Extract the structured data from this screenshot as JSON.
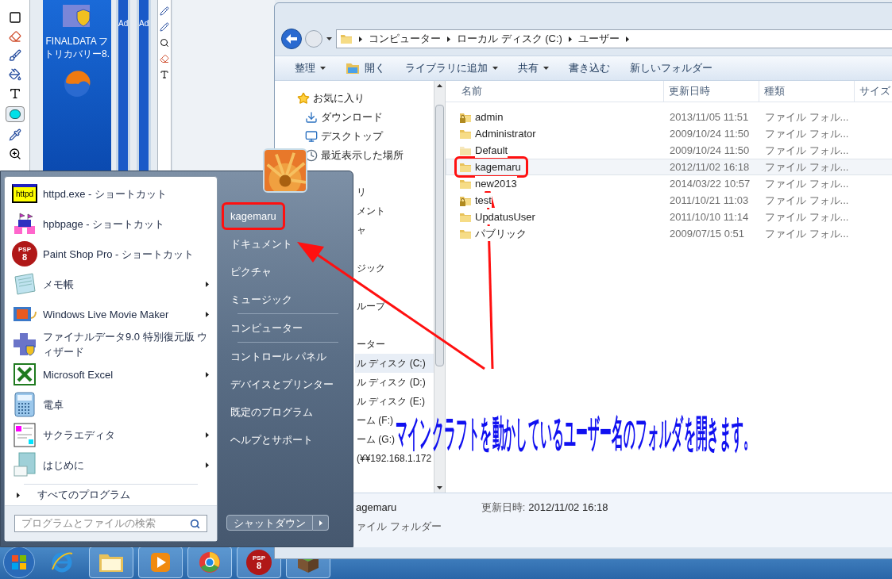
{
  "desktop": {
    "icon_label": [
      "FINALDATA フ",
      "トリカバリー8."
    ],
    "window_fragments": [
      "Ad",
      "Ad"
    ]
  },
  "explorer": {
    "breadcrumb": [
      "コンピューター",
      "ローカル ディスク (C:)",
      "ユーザー"
    ],
    "toolbar": [
      {
        "label": "整理",
        "dropdown": true,
        "kind": "text"
      },
      {
        "label": "開く",
        "dropdown": false,
        "kind": "open"
      },
      {
        "label": "ライブラリに追加",
        "dropdown": true,
        "kind": "text"
      },
      {
        "label": "共有",
        "dropdown": true,
        "kind": "text"
      },
      {
        "label": "書き込む",
        "dropdown": false,
        "kind": "text"
      },
      {
        "label": "新しいフォルダー",
        "dropdown": false,
        "kind": "text"
      }
    ],
    "columns": [
      "名前",
      "更新日時",
      "種類",
      "サイズ"
    ],
    "nav": [
      {
        "label": "お気に入り",
        "kind": "star"
      },
      {
        "label": "ダウンロード",
        "kind": "download"
      },
      {
        "label": "デスクトップ",
        "kind": "desktop"
      },
      {
        "label": "最近表示した場所",
        "kind": "recent"
      }
    ],
    "nav_partial": [
      {
        "label": "リ",
        "selected": false
      },
      {
        "label": "メント",
        "selected": false
      },
      {
        "label": "ャ",
        "selected": false
      },
      {
        "label": "ジック",
        "selected": false
      },
      {
        "label": "ループ",
        "selected": false
      },
      {
        "label": "ーター",
        "selected": false
      },
      {
        "label": "ル ディスク (C:)",
        "selected": true
      },
      {
        "label": "ル ディスク (D:)",
        "selected": false
      },
      {
        "label": "ル ディスク (E:)",
        "selected": false
      },
      {
        "label": "ーム (F:)",
        "selected": false
      },
      {
        "label": "ーム (G:)",
        "selected": false
      },
      {
        "label": "(¥¥192.168.1.172",
        "selected": false
      }
    ],
    "rows": [
      {
        "name": "admin",
        "date": "2013/11/05 11:51",
        "type": "ファイル フォル...",
        "kind": "locked",
        "selected": false,
        "circled": false
      },
      {
        "name": "Administrator",
        "date": "2009/10/24 11:50",
        "type": "ファイル フォル...",
        "kind": "plain",
        "selected": false,
        "circled": false
      },
      {
        "name": "Default",
        "date": "2009/10/24 11:50",
        "type": "ファイル フォル...",
        "kind": "faint",
        "selected": false,
        "circled": false
      },
      {
        "name": "kagemaru",
        "date": "2012/11/02 16:18",
        "type": "ファイル フォル...",
        "kind": "plain",
        "selected": true,
        "circled": true
      },
      {
        "name": "new2013",
        "date": "2014/03/22 10:57",
        "type": "ファイル フォル...",
        "kind": "plain",
        "selected": false,
        "circled": false
      },
      {
        "name": "test",
        "date": "2011/10/21 11:03",
        "type": "ファイル フォル...",
        "kind": "locked",
        "selected": false,
        "circled": false
      },
      {
        "name": "UpdatusUser",
        "date": "2011/10/10 11:14",
        "type": "ファイル フォル...",
        "kind": "plain",
        "selected": false,
        "circled": false
      },
      {
        "name": "パブリック",
        "date": "2009/07/15 0:51",
        "type": "ファイル フォル...",
        "kind": "plain",
        "selected": false,
        "circled": false
      }
    ],
    "details": {
      "name": "agemaru",
      "date_label": "更新日時:",
      "date": "2012/11/02 16:18",
      "type": "ァイル フォルダー"
    }
  },
  "start_menu": {
    "programs": [
      {
        "label": "httpd.exe - ショートカット",
        "kind": "httpd",
        "icon_text": [
          "httpd"
        ],
        "submenu": false
      },
      {
        "label": "hpbpage - ショートカット",
        "kind": "castle",
        "submenu": false
      },
      {
        "label": "Paint Shop Pro - ショートカット",
        "kind": "psp",
        "icon_text": [
          "PSP",
          "8"
        ],
        "submenu": false
      },
      {
        "label": "メモ帳",
        "kind": "notepad",
        "submenu": true
      },
      {
        "label": "Windows Live Movie Maker",
        "kind": "movie",
        "submenu": true
      },
      {
        "label": "ファイナルデータ9.0 特別復元版 ウィザード",
        "kind": "finaldata",
        "submenu": false
      },
      {
        "label": "Microsoft Excel",
        "kind": "excel",
        "submenu": true
      },
      {
        "label": "電卓",
        "kind": "calc",
        "submenu": false
      },
      {
        "label": "サクラエディタ",
        "kind": "sakura",
        "submenu": true
      },
      {
        "label": "はじめに",
        "kind": "intro",
        "submenu": true
      }
    ],
    "all_programs": "すべてのプログラム",
    "search_placeholder": "プログラムとファイルの検索",
    "places": [
      {
        "label": "kagemaru",
        "separator_before": false,
        "circled": true
      },
      {
        "label": "ドキュメント",
        "separator_before": false,
        "circled": false
      },
      {
        "label": "ピクチャ",
        "separator_before": false,
        "circled": false
      },
      {
        "label": "ミュージック",
        "separator_before": false,
        "circled": false
      },
      {
        "label": "コンピューター",
        "separator_before": true,
        "circled": false
      },
      {
        "label": "コントロール パネル",
        "separator_before": true,
        "circled": false
      },
      {
        "label": "デバイスとプリンター",
        "separator_before": false,
        "circled": false
      },
      {
        "label": "既定のプログラム",
        "separator_before": false,
        "circled": false
      },
      {
        "label": "ヘルプとサポート",
        "separator_before": false,
        "circled": false
      }
    ],
    "shutdown": "シャットダウン"
  },
  "taskbar": [
    {
      "kind": "ie",
      "open": false
    },
    {
      "kind": "explorer",
      "open": true
    },
    {
      "kind": "media",
      "open": true
    },
    {
      "kind": "chrome",
      "open": true
    },
    {
      "kind": "psp",
      "open": true,
      "icon_text": [
        "PSP",
        "8"
      ]
    },
    {
      "kind": "minecraft",
      "open": true
    }
  ],
  "caption": "マインクラフトを動かしているユーザー名のフォルダを開きます。"
}
